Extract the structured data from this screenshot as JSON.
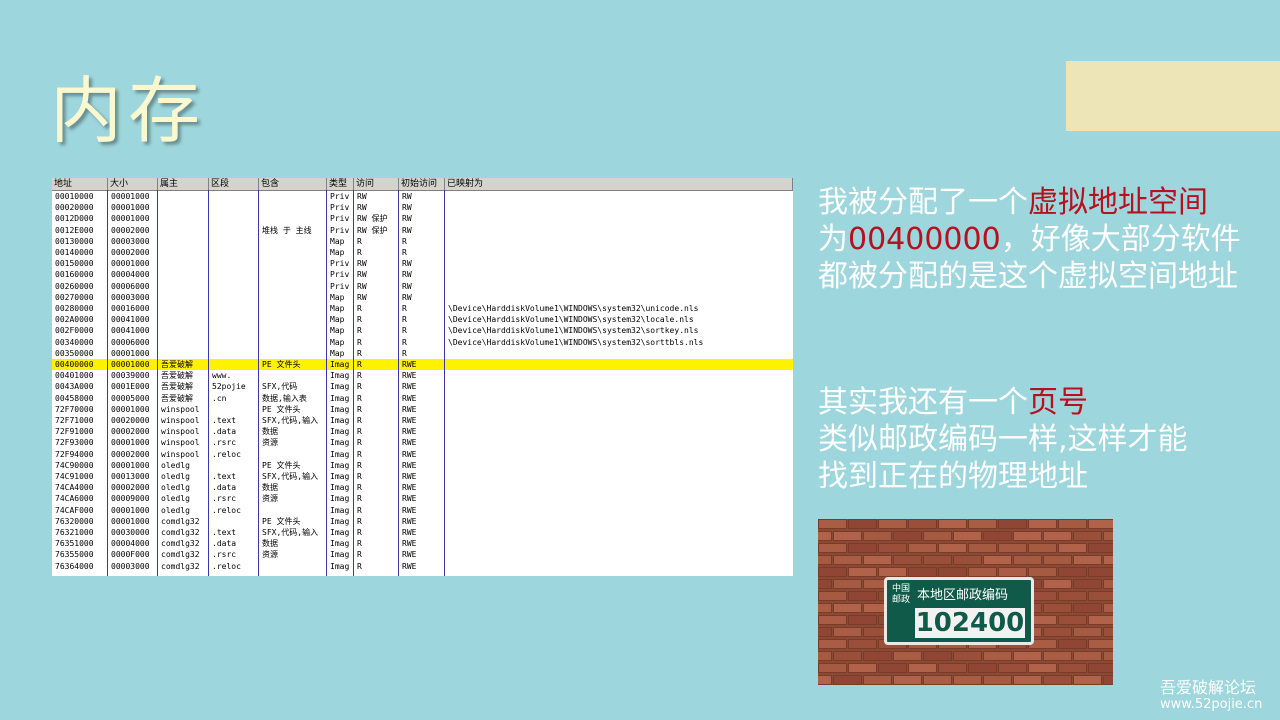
{
  "slide": {
    "title": "内存",
    "side_text_1": {
      "line1_pre": "我被分配了一个",
      "line1_red": "虚拟地址空间",
      "line2_pre": "为",
      "line2_red": "00400000",
      "line2_post": "，好像大部分软件",
      "line3": "都被分配的是这个虚拟空间地址"
    },
    "side_text_2": {
      "line1_pre": "其实我还有一个",
      "line1_red": "页号",
      "line2": "类似邮政编码一样,这样才能",
      "line3": "找到正在的物理地址"
    },
    "photo": {
      "sign_title": "本地区邮政编码",
      "sign_code": "102400",
      "logo_text": "中国邮政"
    },
    "watermark": {
      "line1": "吾爱破解论坛",
      "line2": "www.52pojie.cn"
    },
    "colors": {
      "background": "#9dd6dc",
      "title": "#fbf7cf",
      "accent_red": "#b8101e",
      "highlight_row": "#fff200",
      "beige_block": "#ede4b8"
    }
  },
  "memory_map": {
    "columns": [
      "地址",
      "大小",
      "属主",
      "区段",
      "包含",
      "类型",
      "访问",
      "初始访问",
      "已映射为"
    ],
    "highlight_index": 15,
    "rows": [
      [
        "00010000",
        "00001000",
        "",
        "",
        "",
        "Priv",
        "RW",
        "RW",
        ""
      ],
      [
        "00020000",
        "00001000",
        "",
        "",
        "",
        "Priv",
        "RW",
        "RW",
        ""
      ],
      [
        "0012D000",
        "00001000",
        "",
        "",
        "",
        "Priv",
        "RW  保护",
        "RW",
        ""
      ],
      [
        "0012E000",
        "00002000",
        "",
        "",
        "堆栈 于  主线",
        "Priv",
        "RW  保护",
        "RW",
        ""
      ],
      [
        "00130000",
        "00003000",
        "",
        "",
        "",
        "Map",
        "R",
        "R",
        ""
      ],
      [
        "00140000",
        "00002000",
        "",
        "",
        "",
        "Map",
        "R",
        "R",
        ""
      ],
      [
        "00150000",
        "00001000",
        "",
        "",
        "",
        "Priv",
        "RW",
        "RW",
        ""
      ],
      [
        "00160000",
        "00004000",
        "",
        "",
        "",
        "Priv",
        "RW",
        "RW",
        ""
      ],
      [
        "00260000",
        "00006000",
        "",
        "",
        "",
        "Priv",
        "RW",
        "RW",
        ""
      ],
      [
        "00270000",
        "00003000",
        "",
        "",
        "",
        "Map",
        "RW",
        "RW",
        ""
      ],
      [
        "00280000",
        "00016000",
        "",
        "",
        "",
        "Map",
        "R",
        "R",
        "\\Device\\HarddiskVolume1\\WINDOWS\\system32\\unicode.nls"
      ],
      [
        "002A0000",
        "00041000",
        "",
        "",
        "",
        "Map",
        "R",
        "R",
        "\\Device\\HarddiskVolume1\\WINDOWS\\system32\\locale.nls"
      ],
      [
        "002F0000",
        "00041000",
        "",
        "",
        "",
        "Map",
        "R",
        "R",
        "\\Device\\HarddiskVolume1\\WINDOWS\\system32\\sortkey.nls"
      ],
      [
        "00340000",
        "00006000",
        "",
        "",
        "",
        "Map",
        "R",
        "R",
        "\\Device\\HarddiskVolume1\\WINDOWS\\system32\\sorttbls.nls"
      ],
      [
        "00350000",
        "00001000",
        "",
        "",
        "",
        "Map",
        "R",
        "R",
        ""
      ],
      [
        "00400000",
        "00001000",
        "吾爱破解",
        "",
        "PE 文件头",
        "Imag",
        "R",
        "RWE",
        ""
      ],
      [
        "00401000",
        "00039000",
        "吾爱破解",
        "www.",
        "",
        "Imag",
        "R",
        "RWE",
        ""
      ],
      [
        "0043A000",
        "0001E000",
        "吾爱破解",
        "52pojie",
        "SFX,代码",
        "Imag",
        "R",
        "RWE",
        ""
      ],
      [
        "00458000",
        "00005000",
        "吾爱破解",
        ".cn",
        "数据,输入表",
        "Imag",
        "R",
        "RWE",
        ""
      ],
      [
        "72F70000",
        "00001000",
        "winspool",
        "",
        "PE 文件头",
        "Imag",
        "R",
        "RWE",
        ""
      ],
      [
        "72F71000",
        "00020000",
        "winspool",
        ".text",
        "SFX,代码,输入",
        "Imag",
        "R",
        "RWE",
        ""
      ],
      [
        "72F91000",
        "00002000",
        "winspool",
        ".data",
        "数据",
        "Imag",
        "R",
        "RWE",
        ""
      ],
      [
        "72F93000",
        "00001000",
        "winspool",
        ".rsrc",
        "资源",
        "Imag",
        "R",
        "RWE",
        ""
      ],
      [
        "72F94000",
        "00002000",
        "winspool",
        ".reloc",
        "",
        "Imag",
        "R",
        "RWE",
        ""
      ],
      [
        "74C90000",
        "00001000",
        "oledlg",
        "",
        "PE 文件头",
        "Imag",
        "R",
        "RWE",
        ""
      ],
      [
        "74C91000",
        "00013000",
        "oledlg",
        ".text",
        "SFX,代码,输入",
        "Imag",
        "R",
        "RWE",
        ""
      ],
      [
        "74CA4000",
        "00002000",
        "oledlg",
        ".data",
        "数据",
        "Imag",
        "R",
        "RWE",
        ""
      ],
      [
        "74CA6000",
        "00009000",
        "oledlg",
        ".rsrc",
        "资源",
        "Imag",
        "R",
        "RWE",
        ""
      ],
      [
        "74CAF000",
        "00001000",
        "oledlg",
        ".reloc",
        "",
        "Imag",
        "R",
        "RWE",
        ""
      ],
      [
        "76320000",
        "00001000",
        "comdlg32",
        "",
        "PE 文件头",
        "Imag",
        "R",
        "RWE",
        ""
      ],
      [
        "76321000",
        "00030000",
        "comdlg32",
        ".text",
        "SFX,代码,输入",
        "Imag",
        "R",
        "RWE",
        ""
      ],
      [
        "76351000",
        "00004000",
        "comdlg32",
        ".data",
        "数据",
        "Imag",
        "R",
        "RWE",
        ""
      ],
      [
        "76355000",
        "0000F000",
        "comdlg32",
        ".rsrc",
        "资源",
        "Imag",
        "R",
        "RWE",
        ""
      ],
      [
        "76364000",
        "00003000",
        "comdlg32",
        ".reloc",
        "",
        "Imag",
        "R",
        "RWE",
        ""
      ]
    ]
  }
}
